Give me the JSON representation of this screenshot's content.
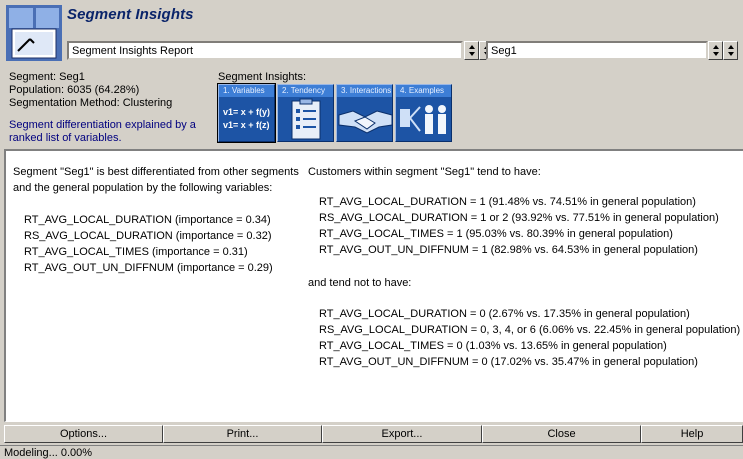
{
  "header": {
    "title": "Segment Insights",
    "report_select": "Segment Insights Report",
    "segment_select": "Seg1"
  },
  "segment_info": {
    "segment": "Segment: Seg1",
    "population": "Population: 6035 (64.28%)",
    "method": "Segmentation Method: Clustering",
    "explanation": "Segment differentiation explained by a ranked list of variables."
  },
  "insights": {
    "label": "Segment Insights:",
    "buttons": [
      {
        "label": "1. Variables",
        "icon": "formula-icon",
        "line1": "v1= x + f(y)",
        "line2": "v1= x + f(z)"
      },
      {
        "label": "2. Tendency",
        "icon": "clipboard-icon"
      },
      {
        "label": "3. Interactions",
        "icon": "handshake-icon"
      },
      {
        "label": "4. Examples",
        "icon": "people-icon"
      }
    ]
  },
  "content": {
    "left_intro_1": "Segment \"Seg1\" is best differentiated from other segments",
    "left_intro_2": "and the general population by the following variables:",
    "variables": [
      "RT_AVG_LOCAL_DURATION (importance = 0.34)",
      "RS_AVG_LOCAL_DURATION (importance = 0.32)",
      "RT_AVG_LOCAL_TIMES (importance = 0.31)",
      "RT_AVG_OUT_UN_DIFFNUM (importance = 0.29)"
    ],
    "right_intro": "Customers within segment \"Seg1\" tend to have:",
    "tend_to_have": [
      "RT_AVG_LOCAL_DURATION = 1 (91.48% vs. 74.51% in general population)",
      "RS_AVG_LOCAL_DURATION = 1 or 2 (93.92% vs. 77.51% in general population)",
      "RT_AVG_LOCAL_TIMES = 1 (95.03% vs. 80.39% in general population)",
      "RT_AVG_OUT_UN_DIFFNUM = 1 (82.98% vs. 64.53% in general population)"
    ],
    "not_intro": "and tend not to have:",
    "tend_not_to_have": [
      "RT_AVG_LOCAL_DURATION = 0 (2.67% vs. 17.35% in general population)",
      "RS_AVG_LOCAL_DURATION = 0, 3, 4, or 6 (6.06% vs. 22.45% in general population)",
      "RT_AVG_LOCAL_TIMES = 0 (1.03% vs. 13.65% in general population)",
      "RT_AVG_OUT_UN_DIFFNUM = 0 (17.02% vs. 35.47% in general population)"
    ]
  },
  "buttons": {
    "options": "Options...",
    "print": "Print...",
    "export": "Export...",
    "close": "Close",
    "help": "Help"
  },
  "status": "Modeling... 0.00%"
}
